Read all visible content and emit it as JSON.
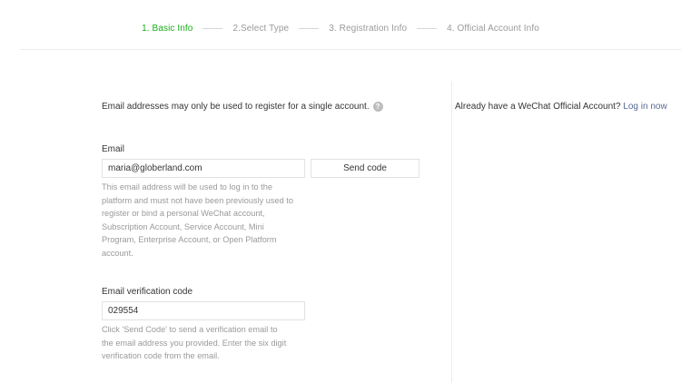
{
  "stepper": {
    "steps": [
      {
        "label": "1. Basic Info",
        "active": true
      },
      {
        "label": "2.Select Type",
        "active": false
      },
      {
        "label": "3. Registration Info",
        "active": false
      },
      {
        "label": "4. Official Account Info",
        "active": false
      }
    ]
  },
  "notice": {
    "text": "Email addresses may only be used to register for a single account.",
    "help_icon": "?"
  },
  "sidebar": {
    "prompt": "Already have a WeChat Official Account?",
    "link": "Log in now"
  },
  "email": {
    "label": "Email",
    "value": "maria@globerland.com",
    "send_label": "Send code",
    "hint": "This email address will be used to log in to the platform and must not have been previously used to register or bind a personal WeChat account, Subscription Account, Service Account, Mini Program, Enterprise Account, or Open Platform account."
  },
  "verification": {
    "label": "Email verification code",
    "value": "029554",
    "hint": "Click 'Send Code' to send a verification email to the email address you provided. Enter the six digit verification code from the email."
  },
  "colors": {
    "active_step": "#1aad19",
    "inactive_step": "#9a9a9a",
    "link": "#576b95",
    "hint_text": "#9a9a9a",
    "border": "#e2e2e2"
  }
}
